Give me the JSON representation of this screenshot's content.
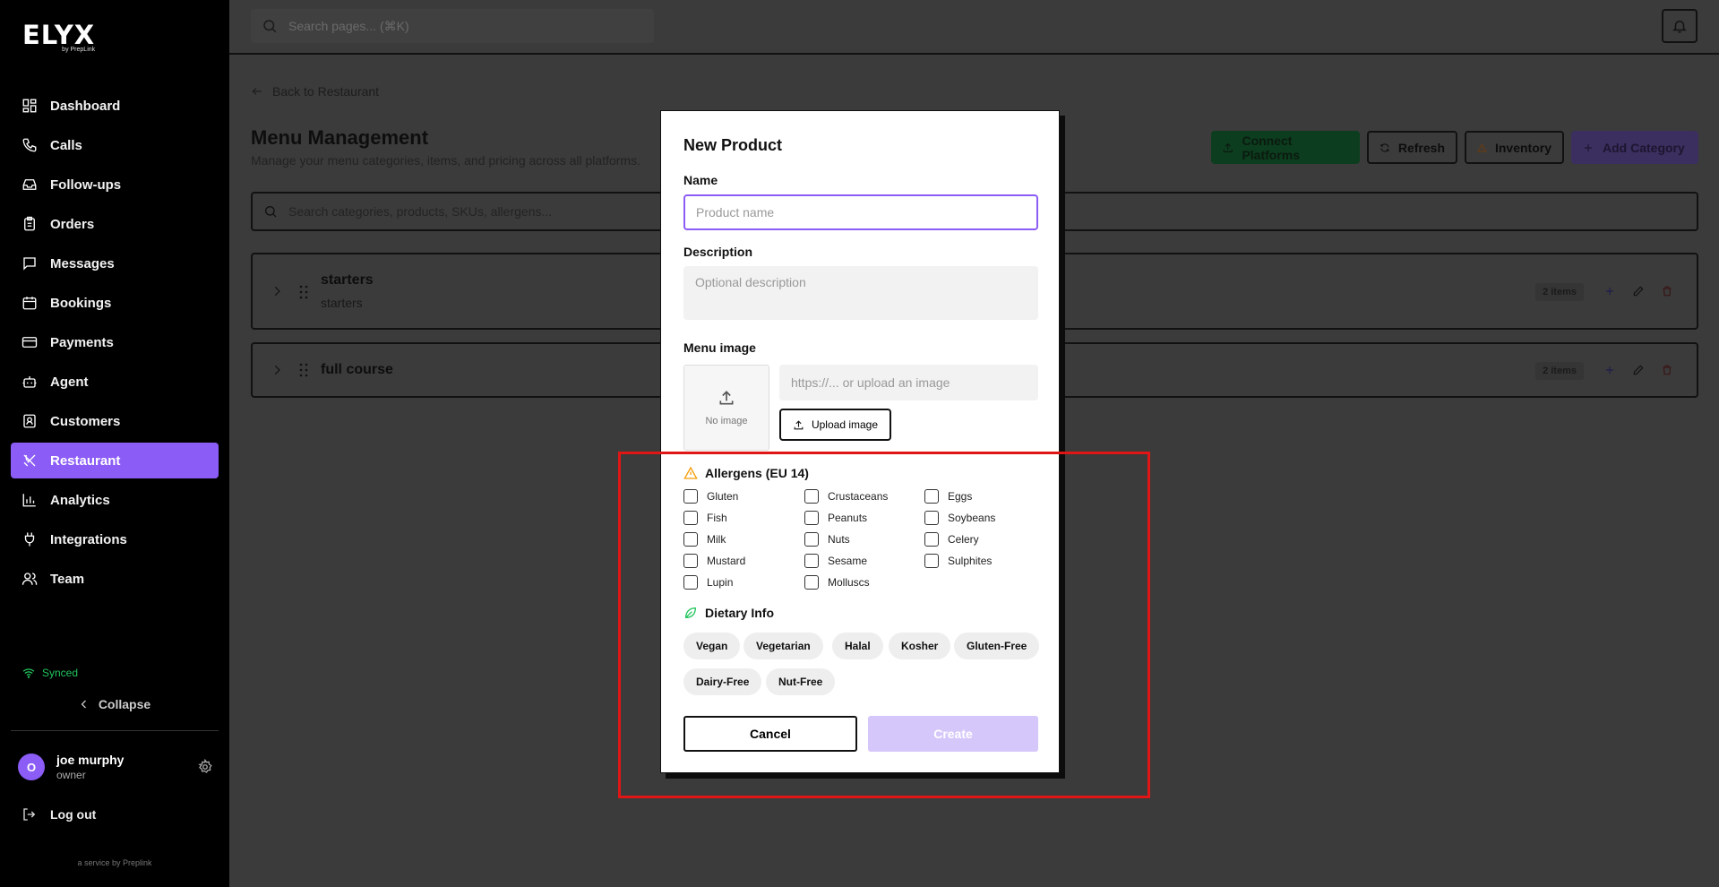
{
  "brand": {
    "name": "ELYX",
    "sub": "by PrepLink"
  },
  "sidebar": {
    "items": [
      {
        "label": "Dashboard",
        "icon": "dashboard-icon"
      },
      {
        "label": "Calls",
        "icon": "phone-icon"
      },
      {
        "label": "Follow-ups",
        "icon": "inbox-icon"
      },
      {
        "label": "Orders",
        "icon": "clipboard-icon"
      },
      {
        "label": "Messages",
        "icon": "message-icon"
      },
      {
        "label": "Bookings",
        "icon": "calendar-icon"
      },
      {
        "label": "Payments",
        "icon": "credit-card-icon"
      },
      {
        "label": "Agent",
        "icon": "bot-icon"
      },
      {
        "label": "Customers",
        "icon": "contact-icon"
      },
      {
        "label": "Restaurant",
        "icon": "utensils-icon",
        "active": true
      },
      {
        "label": "Analytics",
        "icon": "bar-chart-icon"
      },
      {
        "label": "Integrations",
        "icon": "plug-icon"
      },
      {
        "label": "Team",
        "icon": "users-icon"
      }
    ],
    "status": "Synced",
    "collapse_label": "Collapse",
    "user": {
      "initial": "O",
      "name": "joe murphy",
      "role": "owner"
    },
    "logout_label": "Log out",
    "footer": "a service by Preplink"
  },
  "topbar": {
    "search_placeholder": "Search pages... (⌘K)"
  },
  "main": {
    "back_label": "Back to Restaurant",
    "title": "Menu Management",
    "subtitle": "Manage your menu categories, items, and pricing across all platforms.",
    "buttons": {
      "connect": "Connect Platforms",
      "refresh": "Refresh",
      "inventory": "Inventory",
      "add_category": "Add Category"
    },
    "colors": {
      "connect": "#0c3d1e",
      "add_category": "#3b2f5f"
    },
    "search_placeholder": "Search categories, products, SKUs, allergens...",
    "categories": [
      {
        "name": "starters",
        "description": "starters",
        "badge": "2 items"
      },
      {
        "name": "full course",
        "description": "",
        "badge": "2 items"
      }
    ]
  },
  "modal": {
    "title": "New Product",
    "name_label": "Name",
    "name_placeholder": "Product name",
    "description_label": "Description",
    "description_placeholder": "Optional description",
    "image_label": "Menu image",
    "no_image": "No image",
    "image_url_placeholder": "https://... or upload an image",
    "upload_label": "Upload image",
    "allergens_title": "Allergens (EU 14)",
    "allergens": [
      "Gluten",
      "Crustaceans",
      "Eggs",
      "Fish",
      "Peanuts",
      "Soybeans",
      "Milk",
      "Nuts",
      "Celery",
      "Mustard",
      "Sesame",
      "Sulphites",
      "Lupin",
      "Molluscs"
    ],
    "dietary_title": "Dietary Info",
    "dietary": [
      "Vegan",
      "Vegetarian",
      "Halal",
      "Kosher",
      "Gluten-Free",
      "Dairy-Free",
      "Nut-Free"
    ],
    "cancel_label": "Cancel",
    "create_label": "Create"
  },
  "theme": {
    "accent": "#8b5cf6",
    "success": "#22c55e",
    "warning": "#f59e0b",
    "highlight": "#e01515"
  }
}
